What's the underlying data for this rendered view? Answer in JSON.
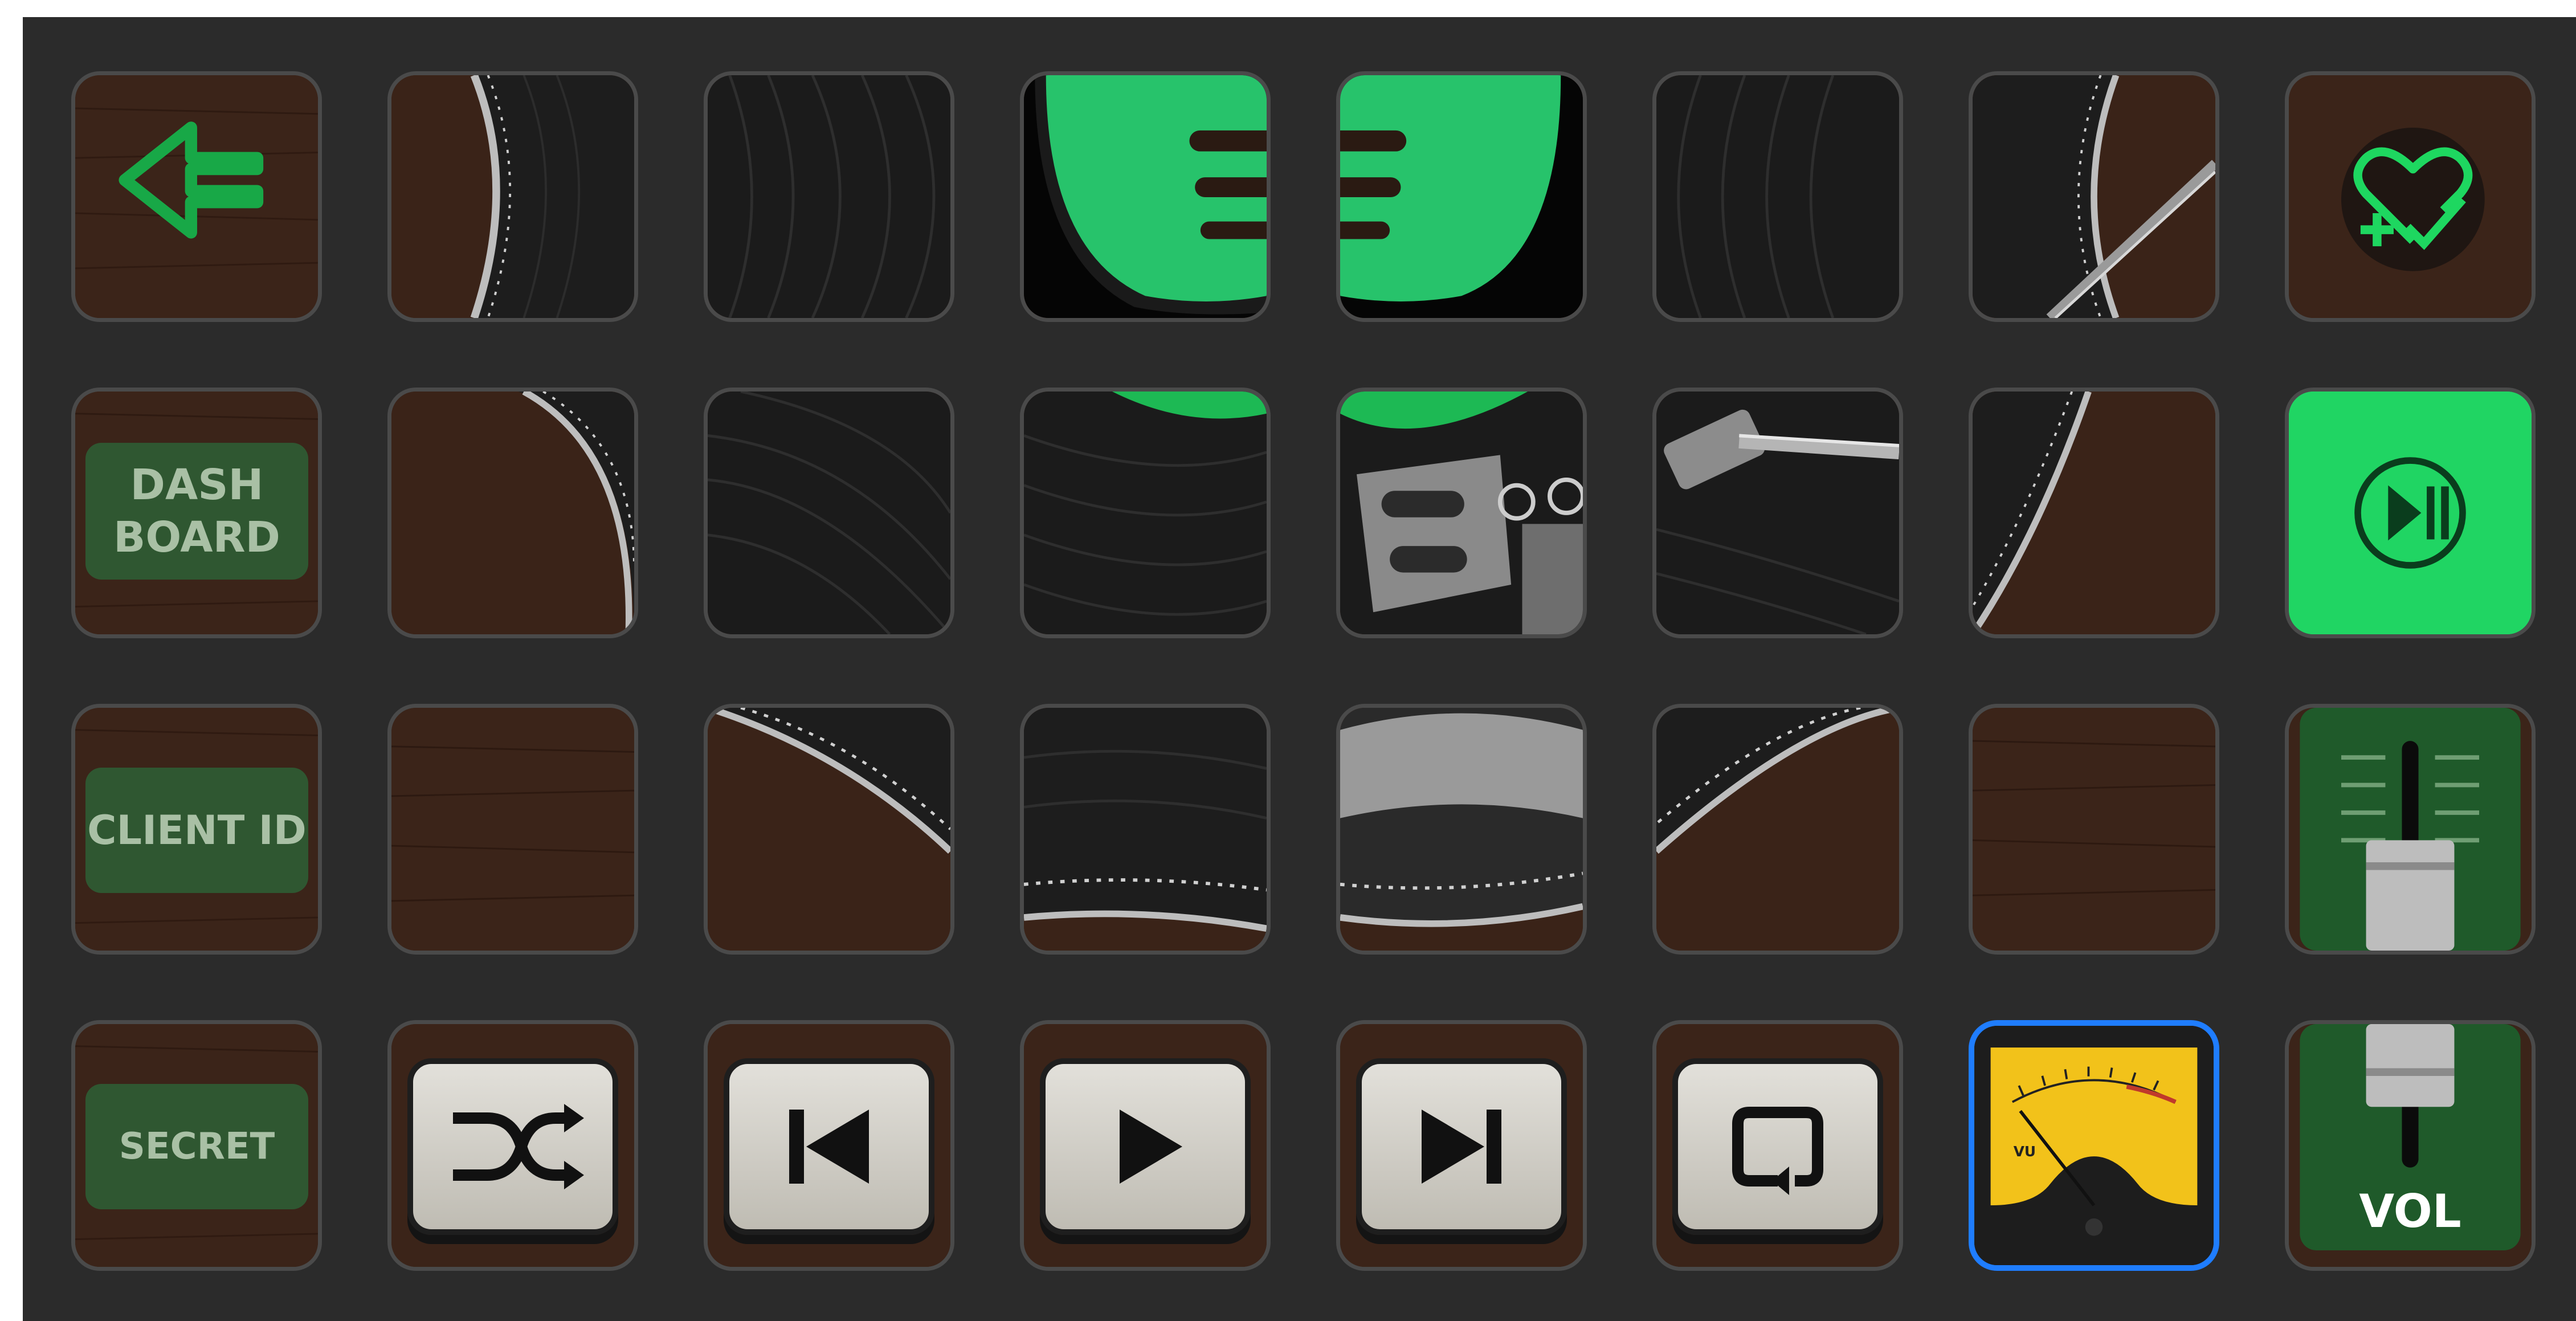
{
  "deck": {
    "rows": [
      [
        {
          "name": "back-arrow-icon",
          "type": "icon",
          "interactable": true
        },
        {
          "name": "turntable-tile-r1c2",
          "type": "art",
          "interactable": true
        },
        {
          "name": "turntable-tile-r1c3",
          "type": "art",
          "interactable": true
        },
        {
          "name": "spotify-logo-left-tile",
          "type": "art",
          "interactable": true
        },
        {
          "name": "spotify-logo-right-tile",
          "type": "art",
          "interactable": true
        },
        {
          "name": "turntable-tile-r1c6",
          "type": "art",
          "interactable": true
        },
        {
          "name": "turntable-tile-r1c7",
          "type": "art",
          "interactable": true
        },
        {
          "name": "heart-plus-icon",
          "type": "icon",
          "interactable": true
        }
      ],
      [
        {
          "name": "dashboard-button",
          "type": "label",
          "interactable": true
        },
        {
          "name": "turntable-tile-r2c2",
          "type": "art",
          "interactable": true
        },
        {
          "name": "turntable-tile-r2c3",
          "type": "art",
          "interactable": true
        },
        {
          "name": "turntable-tile-r2c4",
          "type": "art",
          "interactable": true
        },
        {
          "name": "tonearm-headshell-tile",
          "type": "art",
          "interactable": true
        },
        {
          "name": "tonearm-tile",
          "type": "art",
          "interactable": true
        },
        {
          "name": "turntable-tile-r2c7",
          "type": "art",
          "interactable": true
        },
        {
          "name": "play-pause-button",
          "type": "icon",
          "interactable": true
        }
      ],
      [
        {
          "name": "client-id-button",
          "type": "label",
          "interactable": true
        },
        {
          "name": "wood-tile-r3c2",
          "type": "art",
          "interactable": true
        },
        {
          "name": "turntable-tile-r3c3",
          "type": "art",
          "interactable": true
        },
        {
          "name": "turntable-tile-r3c4",
          "type": "art",
          "interactable": true
        },
        {
          "name": "turntable-tile-r3c5",
          "type": "art",
          "interactable": true
        },
        {
          "name": "turntable-tile-r3c6",
          "type": "art",
          "interactable": true
        },
        {
          "name": "wood-tile-r3c7",
          "type": "art",
          "interactable": true
        },
        {
          "name": "volume-fader-up-button",
          "type": "art",
          "interactable": true
        }
      ],
      [
        {
          "name": "secret-button",
          "type": "label",
          "interactable": true
        },
        {
          "name": "shuffle-button",
          "type": "icon",
          "interactable": true
        },
        {
          "name": "previous-track-button",
          "type": "icon",
          "interactable": true
        },
        {
          "name": "play-button",
          "type": "icon",
          "interactable": true
        },
        {
          "name": "next-track-button",
          "type": "icon",
          "interactable": true
        },
        {
          "name": "repeat-button",
          "type": "icon",
          "interactable": true
        },
        {
          "name": "vu-meter-display",
          "type": "art",
          "interactable": true,
          "selected": true
        },
        {
          "name": "volume-fader-down-button",
          "type": "label",
          "interactable": true
        }
      ]
    ]
  },
  "labels": {
    "dashboard_line1": "DASH",
    "dashboard_line2": "BOARD",
    "client_id": "CLIENT ID",
    "secret": "SECRET",
    "vol": "VOL"
  },
  "icons": {
    "back": "left-arrow-icon",
    "heart": "heart-plus-check-icon",
    "play_pause": "play-pause-icon",
    "shuffle": "shuffle-icon",
    "previous": "skip-previous-icon",
    "play": "play-icon",
    "next": "skip-next-icon",
    "repeat": "repeat-icon"
  },
  "vu_meter": {
    "needle_level": 0.12
  },
  "colors": {
    "accent_green": "#1ed760",
    "spotify_green": "#1db954",
    "selected_border": "#1f7dff",
    "label_plate": "#2d5f34",
    "wood": "#3a2318",
    "vinyl": "#1c1c1c",
    "vu_yellow": "#f2c21a"
  }
}
